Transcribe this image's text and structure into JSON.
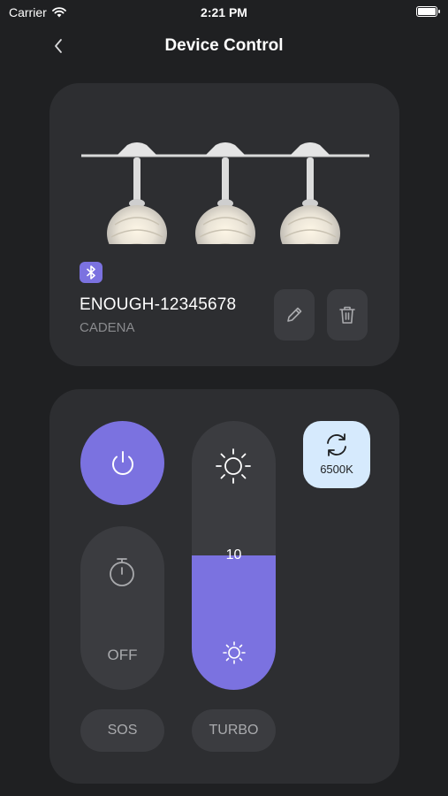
{
  "status_bar": {
    "carrier": "Carrier",
    "time": "2:21 PM",
    "battery_level": 1.0
  },
  "nav": {
    "title": "Device Control",
    "back_icon": "chevron-left-icon"
  },
  "device": {
    "name": "ENOUGH-12345678",
    "type": "CADENA",
    "connection_icon": "bluetooth-icon",
    "edit_icon": "pencil-icon",
    "delete_icon": "trash-icon"
  },
  "controls": {
    "power_icon": "power-icon",
    "timer": {
      "icon": "stopwatch-icon",
      "label": "OFF"
    },
    "brightness": {
      "value": "10",
      "level": 0.5
    },
    "color_temp": {
      "icon": "refresh-icon",
      "label": "6500K"
    },
    "modes": [
      {
        "label": "SOS"
      },
      {
        "label": "TURBO"
      }
    ]
  },
  "colors": {
    "background": "#1f2022",
    "card": "#2d2e31",
    "control": "#3b3c40",
    "accent": "#7b72e0",
    "cct_active": "#d6eafd"
  }
}
